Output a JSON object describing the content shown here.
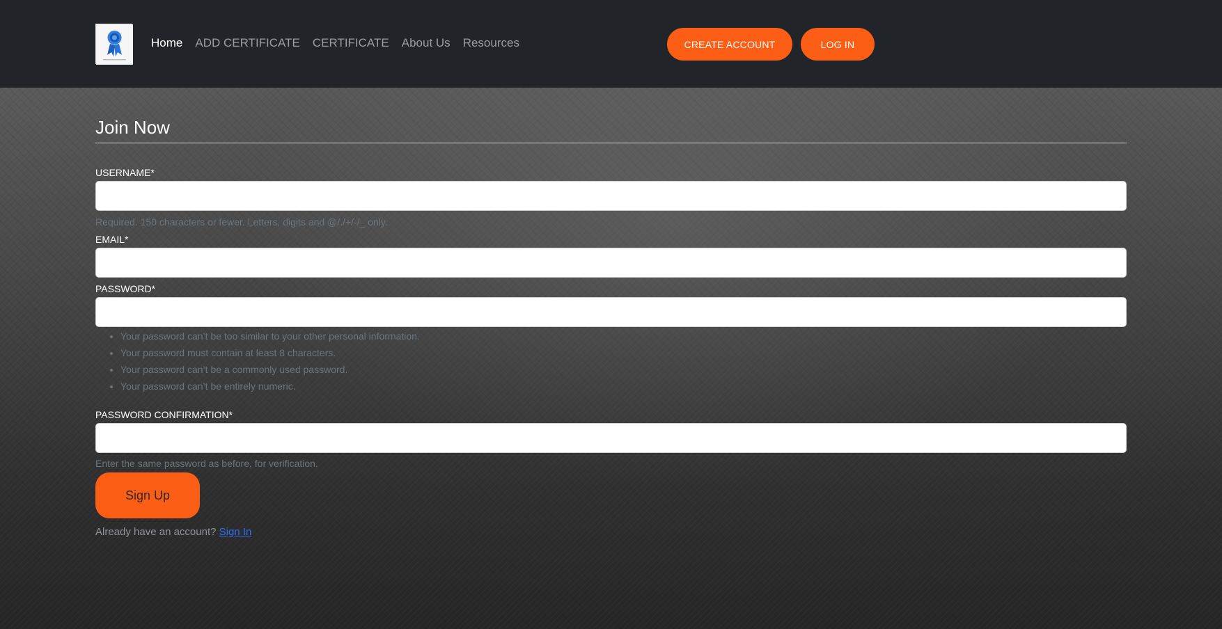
{
  "nav": {
    "items": [
      {
        "label": "Home",
        "active": true
      },
      {
        "label": "ADD CERTIFICATE",
        "active": false
      },
      {
        "label": "CERTIFICATE",
        "active": false
      },
      {
        "label": "About Us",
        "active": false
      },
      {
        "label": "Resources",
        "active": false
      }
    ],
    "create_account_label": "CREATE ACCOUNT",
    "login_label": "LOG IN",
    "logo_icon": "certificate-ribbon-icon"
  },
  "form": {
    "title": "Join Now",
    "username": {
      "label": "USERNAME*",
      "value": "",
      "help": "Required. 150 characters or fewer. Letters, digits and @/./+/-/_ only."
    },
    "email": {
      "label": "EMAIL*",
      "value": ""
    },
    "password": {
      "label": "PASSWORD*",
      "value": "",
      "rules": [
        "Your password can’t be too similar to your other personal information.",
        "Your password must contain at least 8 characters.",
        "Your password can’t be a commonly used password.",
        "Your password can’t be entirely numeric."
      ]
    },
    "password_confirmation": {
      "label": "PASSWORD CONFIRMATION*",
      "value": "",
      "help": "Enter the same password as before, for verification."
    },
    "submit_label": "Sign Up",
    "already_text": "Already have an account?",
    "signin_link": "Sign In"
  },
  "colors": {
    "navbar_bg": "#212529",
    "accent": "#fd5e16",
    "link": "#2f6df0"
  }
}
